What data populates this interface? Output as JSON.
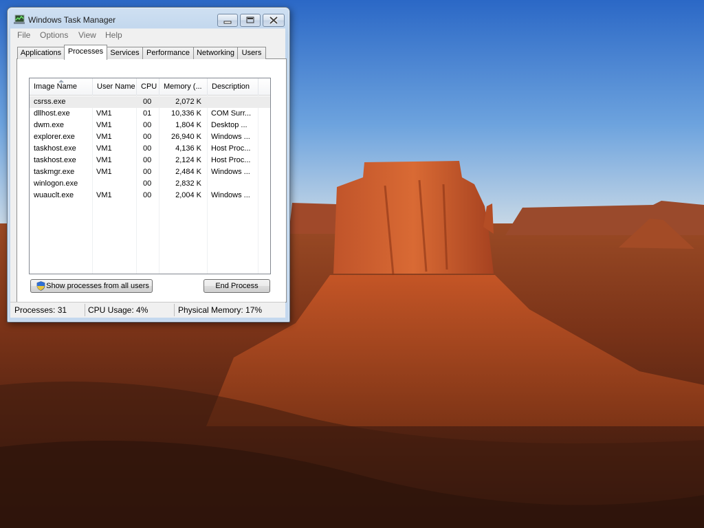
{
  "window": {
    "title": "Windows Task Manager"
  },
  "menu": [
    "File",
    "Options",
    "View",
    "Help"
  ],
  "tabs": [
    "Applications",
    "Processes",
    "Services",
    "Performance",
    "Networking",
    "Users"
  ],
  "active_tab": "Processes",
  "columns": [
    "Image Name",
    "User Name",
    "CPU",
    "Memory (...",
    "Description"
  ],
  "processes": [
    {
      "name": "csrss.exe",
      "user": "",
      "cpu": "00",
      "mem": "2,072 K",
      "desc": ""
    },
    {
      "name": "dllhost.exe",
      "user": "VM1",
      "cpu": "01",
      "mem": "10,336 K",
      "desc": "COM Surr..."
    },
    {
      "name": "dwm.exe",
      "user": "VM1",
      "cpu": "00",
      "mem": "1,804 K",
      "desc": "Desktop ..."
    },
    {
      "name": "explorer.exe",
      "user": "VM1",
      "cpu": "00",
      "mem": "26,940 K",
      "desc": "Windows ..."
    },
    {
      "name": "taskhost.exe",
      "user": "VM1",
      "cpu": "00",
      "mem": "4,136 K",
      "desc": "Host Proc..."
    },
    {
      "name": "taskhost.exe",
      "user": "VM1",
      "cpu": "00",
      "mem": "2,124 K",
      "desc": "Host Proc..."
    },
    {
      "name": "taskmgr.exe",
      "user": "VM1",
      "cpu": "00",
      "mem": "2,484 K",
      "desc": "Windows ..."
    },
    {
      "name": "winlogon.exe",
      "user": "",
      "cpu": "00",
      "mem": "2,832 K",
      "desc": ""
    },
    {
      "name": "wuauclt.exe",
      "user": "VM1",
      "cpu": "00",
      "mem": "2,004 K",
      "desc": "Windows ..."
    }
  ],
  "buttons": {
    "show_all": "Show processes from all users",
    "end_process": "End Process"
  },
  "status": {
    "processes": "Processes: 31",
    "cpu": "CPU Usage: 4%",
    "memory": "Physical Memory: 17%"
  },
  "colors": {
    "window_frame": "#c4d8ee",
    "selection": "#ececec"
  }
}
